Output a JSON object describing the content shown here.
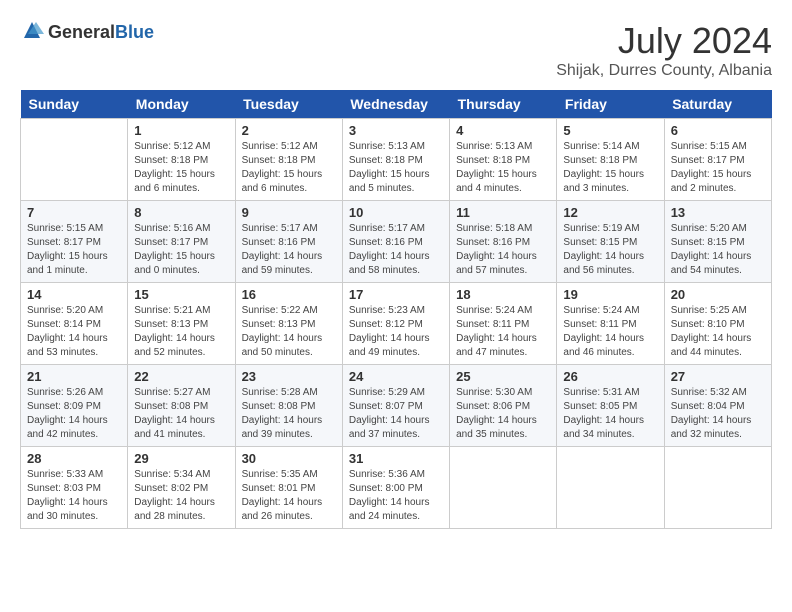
{
  "header": {
    "logo_general": "General",
    "logo_blue": "Blue",
    "title": "July 2024",
    "subtitle": "Shijak, Durres County, Albania"
  },
  "days_of_week": [
    "Sunday",
    "Monday",
    "Tuesday",
    "Wednesday",
    "Thursday",
    "Friday",
    "Saturday"
  ],
  "weeks": [
    [
      {
        "day": "",
        "info": ""
      },
      {
        "day": "1",
        "info": "Sunrise: 5:12 AM\nSunset: 8:18 PM\nDaylight: 15 hours\nand 6 minutes."
      },
      {
        "day": "2",
        "info": "Sunrise: 5:12 AM\nSunset: 8:18 PM\nDaylight: 15 hours\nand 6 minutes."
      },
      {
        "day": "3",
        "info": "Sunrise: 5:13 AM\nSunset: 8:18 PM\nDaylight: 15 hours\nand 5 minutes."
      },
      {
        "day": "4",
        "info": "Sunrise: 5:13 AM\nSunset: 8:18 PM\nDaylight: 15 hours\nand 4 minutes."
      },
      {
        "day": "5",
        "info": "Sunrise: 5:14 AM\nSunset: 8:18 PM\nDaylight: 15 hours\nand 3 minutes."
      },
      {
        "day": "6",
        "info": "Sunrise: 5:15 AM\nSunset: 8:17 PM\nDaylight: 15 hours\nand 2 minutes."
      }
    ],
    [
      {
        "day": "7",
        "info": "Sunrise: 5:15 AM\nSunset: 8:17 PM\nDaylight: 15 hours\nand 1 minute."
      },
      {
        "day": "8",
        "info": "Sunrise: 5:16 AM\nSunset: 8:17 PM\nDaylight: 15 hours\nand 0 minutes."
      },
      {
        "day": "9",
        "info": "Sunrise: 5:17 AM\nSunset: 8:16 PM\nDaylight: 14 hours\nand 59 minutes."
      },
      {
        "day": "10",
        "info": "Sunrise: 5:17 AM\nSunset: 8:16 PM\nDaylight: 14 hours\nand 58 minutes."
      },
      {
        "day": "11",
        "info": "Sunrise: 5:18 AM\nSunset: 8:16 PM\nDaylight: 14 hours\nand 57 minutes."
      },
      {
        "day": "12",
        "info": "Sunrise: 5:19 AM\nSunset: 8:15 PM\nDaylight: 14 hours\nand 56 minutes."
      },
      {
        "day": "13",
        "info": "Sunrise: 5:20 AM\nSunset: 8:15 PM\nDaylight: 14 hours\nand 54 minutes."
      }
    ],
    [
      {
        "day": "14",
        "info": "Sunrise: 5:20 AM\nSunset: 8:14 PM\nDaylight: 14 hours\nand 53 minutes."
      },
      {
        "day": "15",
        "info": "Sunrise: 5:21 AM\nSunset: 8:13 PM\nDaylight: 14 hours\nand 52 minutes."
      },
      {
        "day": "16",
        "info": "Sunrise: 5:22 AM\nSunset: 8:13 PM\nDaylight: 14 hours\nand 50 minutes."
      },
      {
        "day": "17",
        "info": "Sunrise: 5:23 AM\nSunset: 8:12 PM\nDaylight: 14 hours\nand 49 minutes."
      },
      {
        "day": "18",
        "info": "Sunrise: 5:24 AM\nSunset: 8:11 PM\nDaylight: 14 hours\nand 47 minutes."
      },
      {
        "day": "19",
        "info": "Sunrise: 5:24 AM\nSunset: 8:11 PM\nDaylight: 14 hours\nand 46 minutes."
      },
      {
        "day": "20",
        "info": "Sunrise: 5:25 AM\nSunset: 8:10 PM\nDaylight: 14 hours\nand 44 minutes."
      }
    ],
    [
      {
        "day": "21",
        "info": "Sunrise: 5:26 AM\nSunset: 8:09 PM\nDaylight: 14 hours\nand 42 minutes."
      },
      {
        "day": "22",
        "info": "Sunrise: 5:27 AM\nSunset: 8:08 PM\nDaylight: 14 hours\nand 41 minutes."
      },
      {
        "day": "23",
        "info": "Sunrise: 5:28 AM\nSunset: 8:08 PM\nDaylight: 14 hours\nand 39 minutes."
      },
      {
        "day": "24",
        "info": "Sunrise: 5:29 AM\nSunset: 8:07 PM\nDaylight: 14 hours\nand 37 minutes."
      },
      {
        "day": "25",
        "info": "Sunrise: 5:30 AM\nSunset: 8:06 PM\nDaylight: 14 hours\nand 35 minutes."
      },
      {
        "day": "26",
        "info": "Sunrise: 5:31 AM\nSunset: 8:05 PM\nDaylight: 14 hours\nand 34 minutes."
      },
      {
        "day": "27",
        "info": "Sunrise: 5:32 AM\nSunset: 8:04 PM\nDaylight: 14 hours\nand 32 minutes."
      }
    ],
    [
      {
        "day": "28",
        "info": "Sunrise: 5:33 AM\nSunset: 8:03 PM\nDaylight: 14 hours\nand 30 minutes."
      },
      {
        "day": "29",
        "info": "Sunrise: 5:34 AM\nSunset: 8:02 PM\nDaylight: 14 hours\nand 28 minutes."
      },
      {
        "day": "30",
        "info": "Sunrise: 5:35 AM\nSunset: 8:01 PM\nDaylight: 14 hours\nand 26 minutes."
      },
      {
        "day": "31",
        "info": "Sunrise: 5:36 AM\nSunset: 8:00 PM\nDaylight: 14 hours\nand 24 minutes."
      },
      {
        "day": "",
        "info": ""
      },
      {
        "day": "",
        "info": ""
      },
      {
        "day": "",
        "info": ""
      }
    ]
  ]
}
